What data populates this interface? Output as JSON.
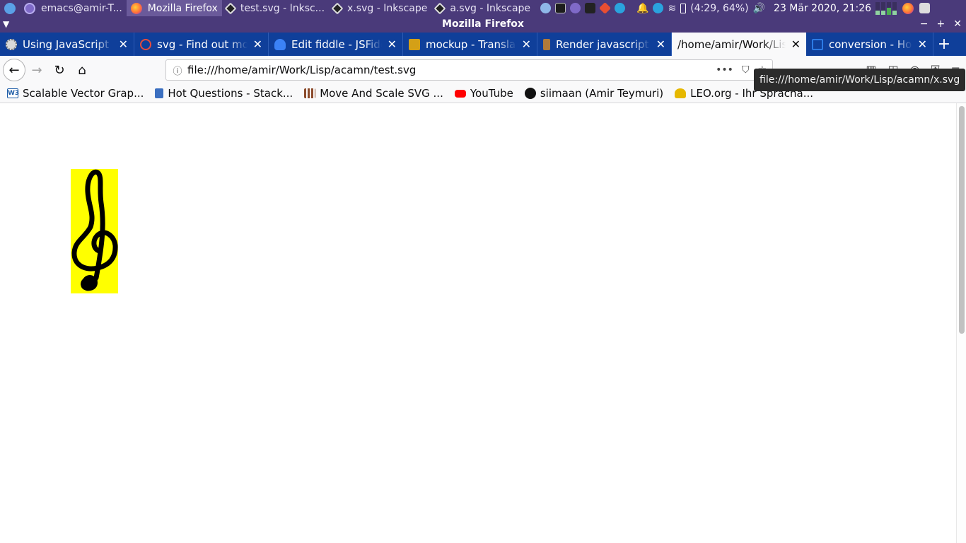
{
  "taskbar": {
    "items": [
      {
        "label": "emacs@amir-T..."
      },
      {
        "label": "Mozilla Firefox"
      },
      {
        "label": "test.svg - Inksc..."
      },
      {
        "label": "x.svg - Inkscape"
      },
      {
        "label": "a.svg - Inkscape"
      }
    ],
    "battery": "(4:29, 64%)",
    "clock": "23 Mär 2020, 21:26"
  },
  "window": {
    "title": "Mozilla Firefox"
  },
  "tabs": [
    {
      "label": "Using JavaScript in",
      "icon": "gear-icon",
      "color": "#d9d9d9"
    },
    {
      "label": "svg - Find out mov",
      "icon": "circle-icon",
      "color": "#e74c3c"
    },
    {
      "label": "Edit fiddle - JSFiddl",
      "icon": "cloud-icon",
      "color": "#3b82f6"
    },
    {
      "label": "mockup - Translati",
      "icon": "lambda-icon",
      "color": "#d4a017"
    },
    {
      "label": "Render javascript i",
      "icon": "stack-icon",
      "color": "#b07a3a"
    },
    {
      "label": "/home/amir/Work/Lisp",
      "icon": "",
      "color": ""
    },
    {
      "label": "conversion - How c",
      "icon": "bracket-icon",
      "color": "#2c7be5"
    }
  ],
  "urlbar": {
    "url": "file:///home/amir/Work/Lisp/acamn/test.svg"
  },
  "bookmarks": [
    {
      "label": "Scalable Vector Grap...",
      "icon": "w3c-icon",
      "color": "#1a5aa6"
    },
    {
      "label": "Hot Questions - Stack...",
      "icon": "stack-exchange-icon",
      "color": "#3b6fc0"
    },
    {
      "label": "Move And Scale SVG ...",
      "icon": "grid-icon",
      "color": "#8b4a2b"
    },
    {
      "label": "YouTube",
      "icon": "youtube-icon",
      "color": "#ff0000"
    },
    {
      "label": "siimaan (Amir Teymuri)",
      "icon": "github-icon",
      "color": "#111111"
    },
    {
      "label": "LEO.org - Ihr Spracha...",
      "icon": "leo-icon",
      "color": "#e6b800"
    }
  ],
  "tooltip": {
    "text": "file:///home/amir/Work/Lisp/acamn/x.svg"
  },
  "content": {
    "svg_background": "#ffff00",
    "glyph": "treble-clef"
  }
}
